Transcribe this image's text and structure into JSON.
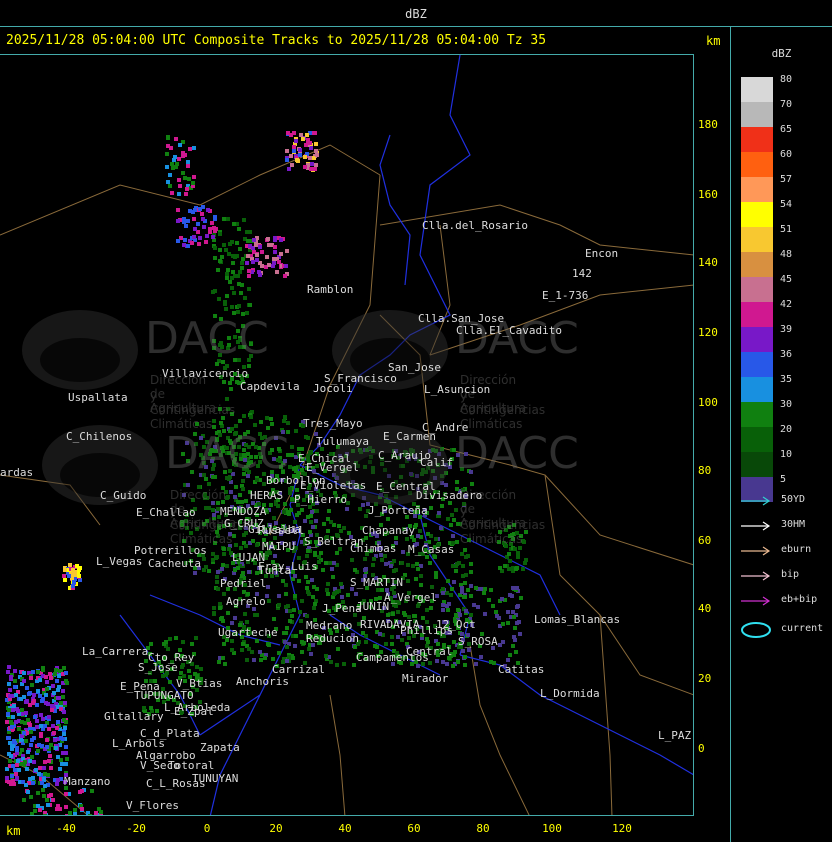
{
  "top_title": "dBZ",
  "header": "2025/11/28 05:04:00 UTC Composite Tracks to 2025/11/28 05:04:00 Tz 35",
  "axis_unit": "km",
  "y_ticks": [
    "180",
    "160",
    "140",
    "120",
    "100",
    "80",
    "60",
    "40",
    "20",
    "0"
  ],
  "x_ticks": [
    "-40",
    "-20",
    "0",
    "20",
    "40",
    "60",
    "80",
    "100",
    "120"
  ],
  "legend": {
    "title": "dBZ",
    "levels": [
      {
        "label": "80",
        "color": "#d8d8d8"
      },
      {
        "label": "70",
        "color": "#b8b8b8"
      },
      {
        "label": "65",
        "color": "#f03018"
      },
      {
        "label": "60",
        "color": "#ff6010"
      },
      {
        "label": "57",
        "color": "#ff9858"
      },
      {
        "label": "54",
        "color": "#ffff00"
      },
      {
        "label": "51",
        "color": "#f8c830"
      },
      {
        "label": "48",
        "color": "#d89040"
      },
      {
        "label": "45",
        "color": "#c87090"
      },
      {
        "label": "42",
        "color": "#d01890"
      },
      {
        "label": "39",
        "color": "#7818c8"
      },
      {
        "label": "36",
        "color": "#2858e8"
      },
      {
        "label": "35",
        "color": "#1890e0"
      },
      {
        "label": "30",
        "color": "#108010"
      },
      {
        "label": "20",
        "color": "#086008"
      },
      {
        "label": "10",
        "color": "#084808"
      },
      {
        "label": "5",
        "color": "#483890"
      }
    ],
    "tracks": [
      {
        "label": "50YD",
        "color": "#30d0d0"
      },
      {
        "label": "30HM",
        "color": "#ffffff"
      },
      {
        "label": "eburn",
        "color": "#e8b890"
      },
      {
        "label": "bip",
        "color": "#f0c0d0"
      },
      {
        "label": "eb+bip",
        "color": "#d030d0"
      }
    ],
    "current_label": "current"
  },
  "watermark": {
    "name": "DACC",
    "line1": "Dirección de Agricultura",
    "line2": "y Contingencias Climáticas"
  },
  "places": [
    {
      "name": "Clla.del_Rosario"
    },
    {
      "name": "Encon"
    },
    {
      "name": "142"
    },
    {
      "name": "E_1-736"
    },
    {
      "name": "Ramblon"
    },
    {
      "name": "Clla.San_Jose"
    },
    {
      "name": "Clla.El_Cavadito"
    },
    {
      "name": "Villavicencio"
    },
    {
      "name": "Capdevila"
    },
    {
      "name": "S_Francisco"
    },
    {
      "name": "San_Jose"
    },
    {
      "name": "Jocoli"
    },
    {
      "name": "L_Asuncion"
    },
    {
      "name": "Uspallata"
    },
    {
      "name": "Tres_Mayo"
    },
    {
      "name": "C_Andre"
    },
    {
      "name": "E_Carmen"
    },
    {
      "name": "C_Chilenos"
    },
    {
      "name": "Tulumaya"
    },
    {
      "name": "C_Araujo"
    },
    {
      "name": "E_Chical"
    },
    {
      "name": "Calif"
    },
    {
      "name": "E_Vergel"
    },
    {
      "name": "ardas"
    },
    {
      "name": "Borbollon"
    },
    {
      "name": "E_Violetas"
    },
    {
      "name": "E_Central"
    },
    {
      "name": "Divisadero"
    },
    {
      "name": "C_Guido"
    },
    {
      "name": "HERAS"
    },
    {
      "name": "P_Hierro"
    },
    {
      "name": "E_Challao"
    },
    {
      "name": "MENDOZA"
    },
    {
      "name": "J_Porteña"
    },
    {
      "name": "G_CRUZ"
    },
    {
      "name": "Gillalba"
    },
    {
      "name": "Chapanay"
    },
    {
      "name": "Russell"
    },
    {
      "name": "S_Beltran"
    },
    {
      "name": "Potrerillos"
    },
    {
      "name": "MAIPU"
    },
    {
      "name": "Chimbas"
    },
    {
      "name": "M_Casas"
    },
    {
      "name": "L_Vegas"
    },
    {
      "name": "Cacheuta"
    },
    {
      "name": "LUJAN"
    },
    {
      "name": "Fray_Luis"
    },
    {
      "name": "Pedriel"
    },
    {
      "name": "Tunta"
    },
    {
      "name": "S_MARTIN"
    },
    {
      "name": "Agrelo"
    },
    {
      "name": "A_Vergel"
    },
    {
      "name": "Medrano"
    },
    {
      "name": "J_Pena"
    },
    {
      "name": "JUNIN"
    },
    {
      "name": "Ugarteche"
    },
    {
      "name": "Lomas_Blancas"
    },
    {
      "name": "Reducion"
    },
    {
      "name": "RIVADAVIA"
    },
    {
      "name": "Phillips"
    },
    {
      "name": "12_Oct"
    },
    {
      "name": "S_ROSA"
    },
    {
      "name": "La_Carrera"
    },
    {
      "name": "Cto_Rey"
    },
    {
      "name": "S_Jose"
    },
    {
      "name": "Carrizal"
    },
    {
      "name": "Campamentos"
    },
    {
      "name": "Central"
    },
    {
      "name": "Catitas"
    },
    {
      "name": "E_Pena"
    },
    {
      "name": "V_Btias"
    },
    {
      "name": "Anchoris"
    },
    {
      "name": "Mirador"
    },
    {
      "name": "TUPUNGATO"
    },
    {
      "name": "L_Dormida"
    },
    {
      "name": "L_Arboleda"
    },
    {
      "name": "Gltallary"
    },
    {
      "name": "E_Zpal"
    },
    {
      "name": "L_Arbols"
    },
    {
      "name": "C_d_Plata"
    },
    {
      "name": "Zapata"
    },
    {
      "name": "L_PAZ"
    },
    {
      "name": "Algarrobo"
    },
    {
      "name": "V_Seco"
    },
    {
      "name": "Totoral"
    },
    {
      "name": "TUNUYAN"
    },
    {
      "name": "Manzano"
    },
    {
      "name": "C_L_Rosas"
    },
    {
      "name": "V_Flores"
    }
  ]
}
